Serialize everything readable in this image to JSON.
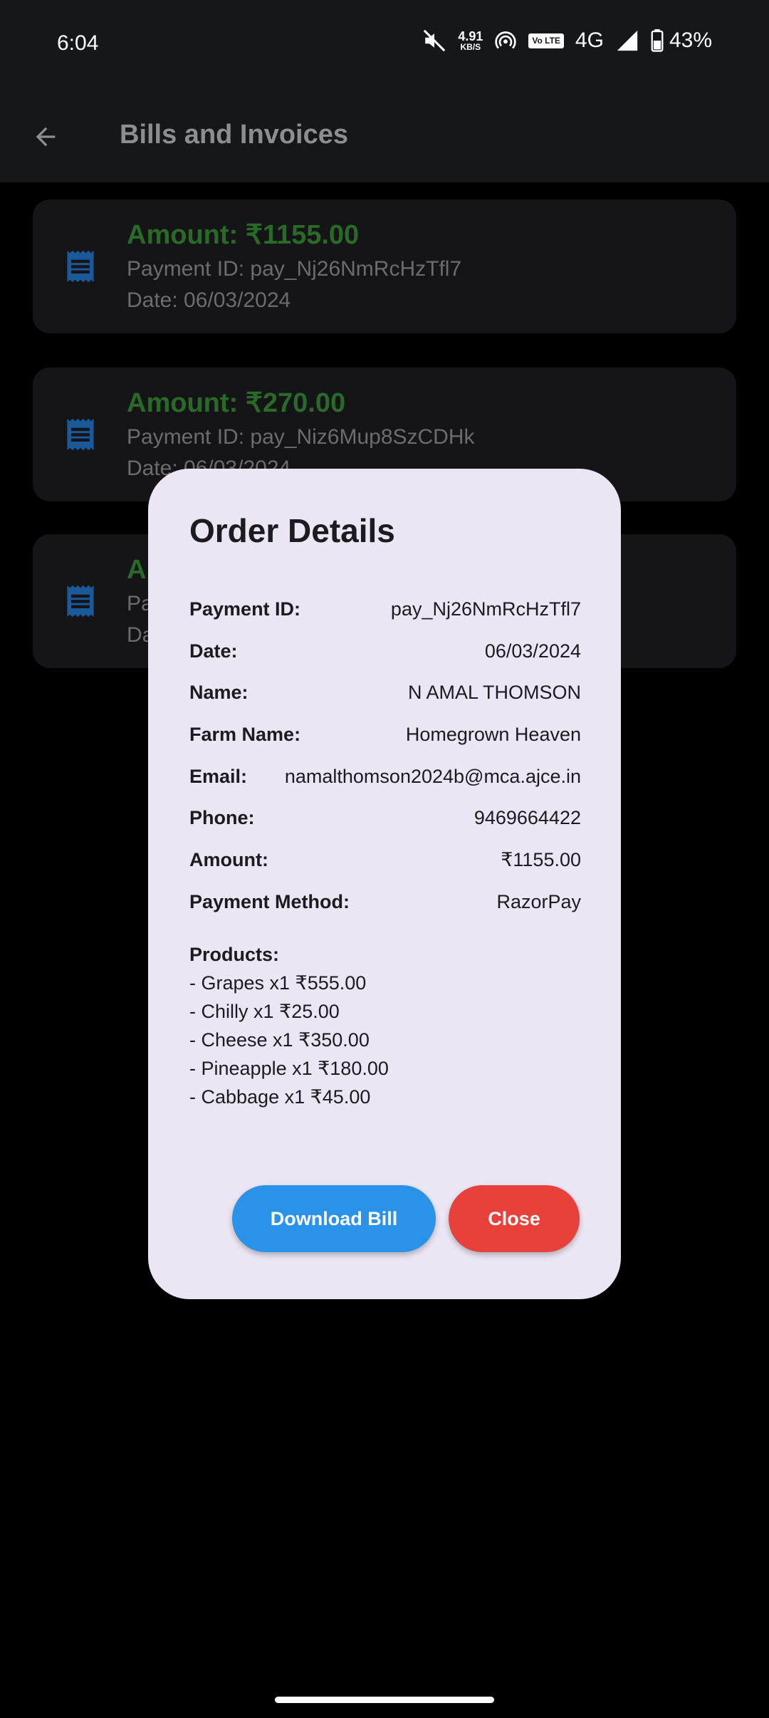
{
  "status_bar": {
    "time": "6:04",
    "net_speed_value": "4.91",
    "net_speed_unit": "KB/S",
    "volte": "Vo LTE",
    "network": "4G",
    "battery": "43%"
  },
  "app_bar": {
    "title": "Bills and Invoices",
    "back_icon": "arrow-left-icon"
  },
  "bills": [
    {
      "amount": "Amount: ₹1155.00",
      "payment_id": "Payment ID: pay_Nj26NmRcHzTfl7",
      "date": "Date: 06/03/2024"
    },
    {
      "amount": "Amount: ₹270.00",
      "payment_id": "Payment ID: pay_Niz6Mup8SzCDHk",
      "date": "Date: 06/03/2024"
    },
    {
      "amount": "A",
      "payment_id": "Pa",
      "date": "Da"
    }
  ],
  "dialog": {
    "title": "Order Details",
    "rows": [
      {
        "label": "Payment ID:",
        "value": "pay_Nj26NmRcHzTfl7"
      },
      {
        "label": "Date:",
        "value": "06/03/2024"
      },
      {
        "label": "Name:",
        "value": "N AMAL THOMSON"
      },
      {
        "label": "Farm Name:",
        "value": "Homegrown Heaven"
      },
      {
        "label": "Email:",
        "value": "namalthomson2024b@mca.ajce.in"
      },
      {
        "label": "Phone:",
        "value": "9469664422"
      },
      {
        "label": "Amount:",
        "value": "₹1155.00"
      },
      {
        "label": "Payment Method:",
        "value": "RazorPay"
      }
    ],
    "products_title": "Products:",
    "products": [
      "- Grapes x1 ₹555.00",
      "- Chilly x1 ₹25.00",
      "- Cheese x1 ₹350.00",
      "- Pineapple x1 ₹180.00",
      "- Cabbage x1 ₹45.00"
    ],
    "download_label": "Download Bill",
    "close_label": "Close"
  },
  "colors": {
    "amount_green": "#2a6a28",
    "icon_blue": "#1a5a9a",
    "dialog_bg": "#ece5f3",
    "download_blue": "#2a92e8",
    "close_red": "#e8403a"
  }
}
